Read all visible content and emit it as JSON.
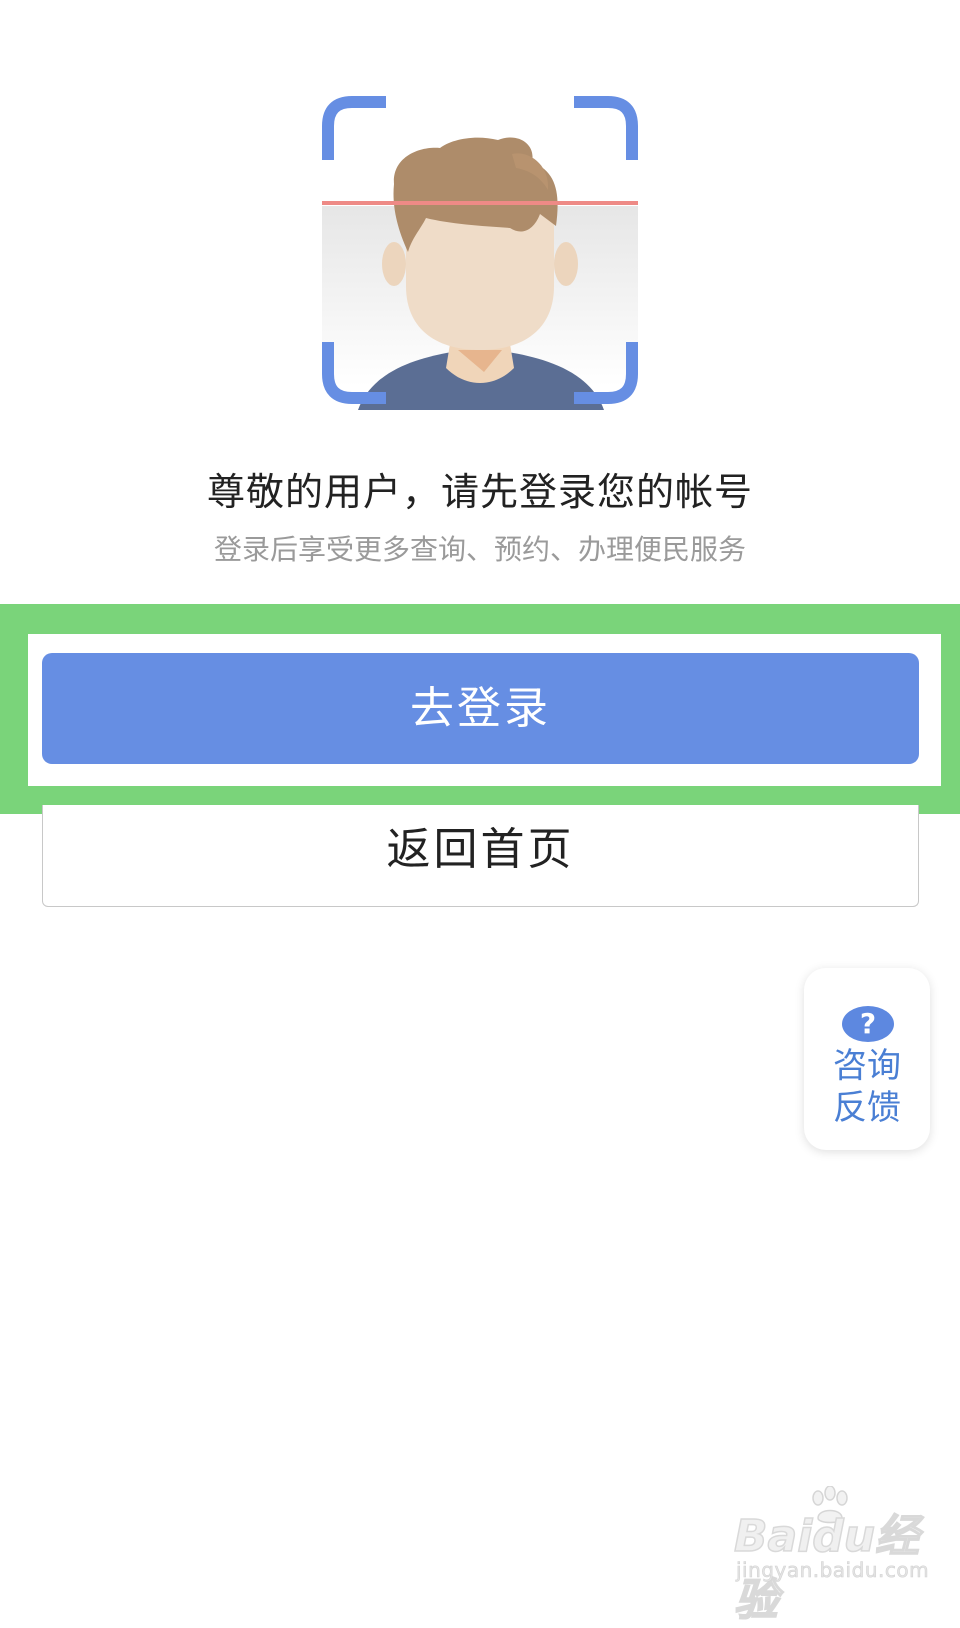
{
  "illustration": {
    "icon": "face-scan-avatar-icon",
    "frame_color": "#668ee3",
    "scan_line_color": "#ee8a86"
  },
  "prompt": {
    "title": "尊敬的用户，请先登录您的帐号",
    "subtitle": "登录后享受更多查询、预约、办理便民服务"
  },
  "actions": {
    "login_label": "去登录",
    "home_label": "返回首页",
    "login_color": "#668ee3"
  },
  "feedback": {
    "icon": "question-icon",
    "icon_glyph": "?",
    "line1": "咨询",
    "line2": "反馈"
  },
  "highlight": {
    "color": "#7ad47a"
  },
  "watermark": {
    "logo": "Baidu经验",
    "url": "jingyan.baidu.com"
  }
}
